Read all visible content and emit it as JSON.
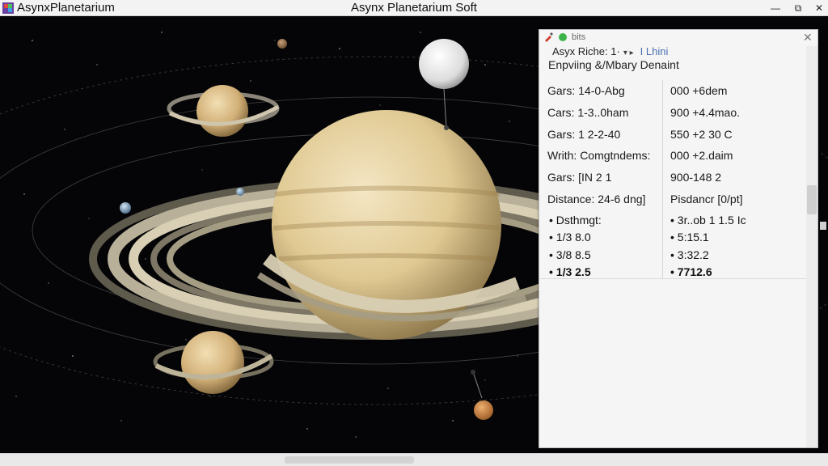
{
  "window": {
    "app_name": "AsynxPlanetarium",
    "title": "Asynx Planetarium Soft",
    "controls": {
      "minimize": "—",
      "maximize": "⧉",
      "close": "✕"
    }
  },
  "panel": {
    "tab_label": "bits",
    "close_glyph": "✕",
    "subtitle_1": "Asyx Riche: 1·",
    "subtitle_1_arrows": "▾ ▸",
    "subtitle_1_hint": "I Lhini",
    "subtitle_2": "Enpviing &/Mbary Denaint",
    "rows": [
      {
        "label": "Gars: 14-0-Abg",
        "value": "000 +6dem"
      },
      {
        "label": "Cars: 1-3..0ham",
        "value": "900 +4.4mao."
      },
      {
        "label": "Gars: 1 2-2-40",
        "value": "550 +2 30 C"
      },
      {
        "label": "Writh: Comgtndems:",
        "value": "000 +2.daim"
      },
      {
        "label": "Gars: [IN 2 1",
        "value": "900-148 2"
      },
      {
        "label": "Distance: 24-6 dng]",
        "value": "Pisdancr [0/pt]"
      }
    ],
    "list": [
      {
        "label": "• Dsthmgt:",
        "value": "• 3r..ob 1 1.5 Ic"
      },
      {
        "label": "• 1/3 8.0",
        "value": "• 5:15.1"
      },
      {
        "label": "• 3/8 8.5",
        "value": "• 3:32.2"
      },
      {
        "label": "• 1/3 2.5",
        "value": "• 7712.6"
      }
    ]
  },
  "colors": {
    "status_dot": "#3cb44a",
    "panel_bg": "#f5f5f5",
    "space_bg": "#050507"
  }
}
